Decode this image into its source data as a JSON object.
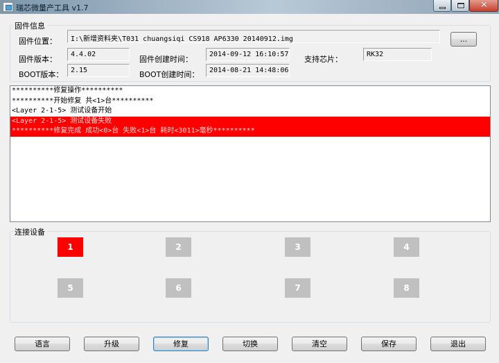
{
  "window": {
    "title": "瑞芯微量产工具 v1.7",
    "close_glyph": "✕"
  },
  "firmware_info": {
    "group_label": "固件信息",
    "path_label": "固件位置：",
    "path_value": "I:\\新增资料夹\\T031_chuangsiqi_CS918_AP6330_20140912.img",
    "browse_label": "...",
    "version_label": "固件版本：",
    "version_value": "4.4.02",
    "create_time_label": "固件创建时间：",
    "create_time_value": "2014-09-12 16:10:57",
    "chip_label": "支持芯片：",
    "chip_value": "RK32",
    "boot_version_label": "BOOT版本：",
    "boot_version_value": "2.15",
    "boot_time_label": "BOOT创建时间：",
    "boot_time_value": "2014-08-21 14:48:06"
  },
  "log": {
    "lines": [
      {
        "text": "**********修复操作**********",
        "error": false
      },
      {
        "text": "**********开始修复 共<1>台**********",
        "error": false
      },
      {
        "text": "<Layer 2-1-5> 测试设备开始",
        "error": false
      },
      {
        "text": "<Layer 2-1-5> 测试设备失败",
        "error": true
      },
      {
        "text": "**********修复完成 成功<0>台 失败<1>台 耗时<3011>毫秒**********",
        "error": true
      }
    ]
  },
  "devices": {
    "group_label": "连接设备",
    "slots": [
      {
        "label": "1",
        "connected": true
      },
      {
        "label": "2",
        "connected": false
      },
      {
        "label": "3",
        "connected": false
      },
      {
        "label": "4",
        "connected": false
      },
      {
        "label": "5",
        "connected": false
      },
      {
        "label": "6",
        "connected": false
      },
      {
        "label": "7",
        "connected": false
      },
      {
        "label": "8",
        "connected": false
      }
    ]
  },
  "buttons": {
    "language": "语言",
    "upgrade": "升级",
    "repair": "修复",
    "switch": "切换",
    "clear": "清空",
    "save": "保存",
    "exit": "退出"
  },
  "colors": {
    "error_row": "#ff0000",
    "device_connected": "#ff0000",
    "device_idle": "#c0c0c0"
  }
}
